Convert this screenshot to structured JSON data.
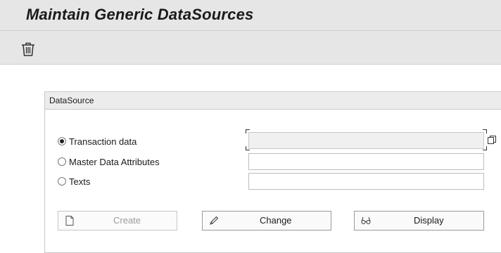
{
  "header": {
    "title": "Maintain Generic DataSources"
  },
  "toolbar": {
    "delete_icon": "trash-icon"
  },
  "datasource_group": {
    "title": "DataSource",
    "options": [
      {
        "label": "Transaction data",
        "selected": true
      },
      {
        "label": "Master Data Attributes",
        "selected": false
      },
      {
        "label": "Texts",
        "selected": false
      }
    ],
    "fields": [
      {
        "value": "",
        "disabled": true
      },
      {
        "value": "",
        "disabled": false
      },
      {
        "value": "",
        "disabled": false
      }
    ]
  },
  "buttons": {
    "create": {
      "label": "Create",
      "icon": "document-icon",
      "enabled": false
    },
    "change": {
      "label": "Change",
      "icon": "pencil-icon",
      "enabled": true
    },
    "display": {
      "label": "Display",
      "icon": "glasses-icon",
      "enabled": true
    }
  }
}
